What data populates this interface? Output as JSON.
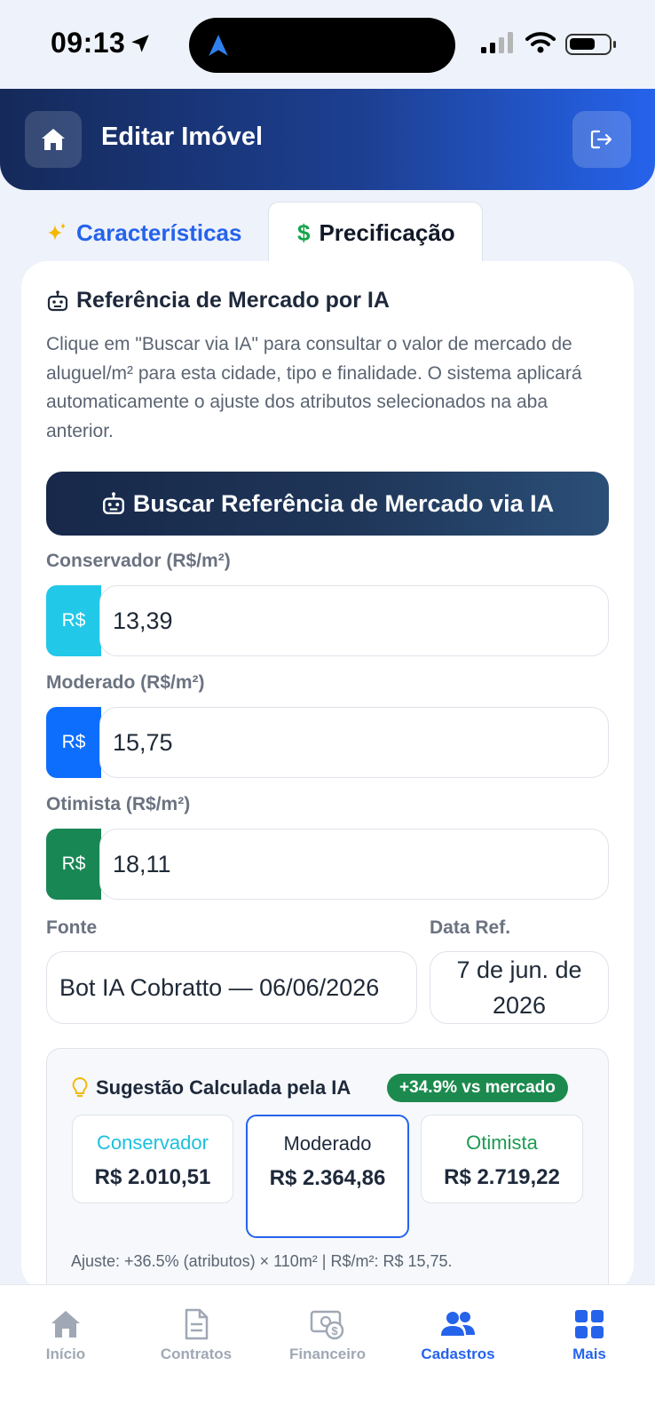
{
  "status_bar": {
    "time": "09:13"
  },
  "header": {
    "title": "Editar Imóvel"
  },
  "tabs": [
    {
      "label": "Características",
      "active": false
    },
    {
      "label": "Precificação",
      "active": true
    }
  ],
  "section": {
    "title": "Referência de Mercado por IA",
    "description": "Clique em \"Buscar via IA\" para consultar o valor de mercado de aluguel/m² para esta cidade, tipo e finalidade. O sistema aplicará automaticamente o ajuste dos atributos selecionados na aba anterior."
  },
  "ai_button": {
    "label": "Buscar Referência de Mercado via IA"
  },
  "prices": {
    "conservador": {
      "label": "Conservador (R$/m²)",
      "prefix": "R$",
      "value": "13,39",
      "color": "#22c8e8"
    },
    "moderado": {
      "label": "Moderado (R$/m²)",
      "prefix": "R$",
      "value": "15,75",
      "color": "#0d6efd"
    },
    "otimista": {
      "label": "Otimista (R$/m²)",
      "prefix": "R$",
      "value": "18,11",
      "color": "#198754"
    }
  },
  "fonte": {
    "label": "Fonte",
    "value": "Bot IA Cobratto — 06/06/2026"
  },
  "data_ref": {
    "label": "Data Ref.",
    "value": "7 de jun. de 2026"
  },
  "suggestion": {
    "title": "Sugestão Calculada pela IA",
    "badge": "+34.9% vs mercado",
    "options": [
      {
        "name": "Conservador",
        "value": "R$ 2.010,51"
      },
      {
        "name": "Moderado",
        "value": "R$ 2.364,86",
        "selected": true
      },
      {
        "name": "Otimista",
        "value": "R$ 2.719,22"
      }
    ],
    "ajuste": "Ajuste: +36.5% (atributos) × 110m² | R$/m²: R$ 15,75."
  },
  "bottom_nav": [
    {
      "label": "Início",
      "icon": "home-icon"
    },
    {
      "label": "Contratos",
      "icon": "document-icon"
    },
    {
      "label": "Financeiro",
      "icon": "money-icon"
    },
    {
      "label": "Cadastros",
      "icon": "users-icon",
      "active": true
    },
    {
      "label": "Mais",
      "icon": "grid-icon"
    }
  ]
}
